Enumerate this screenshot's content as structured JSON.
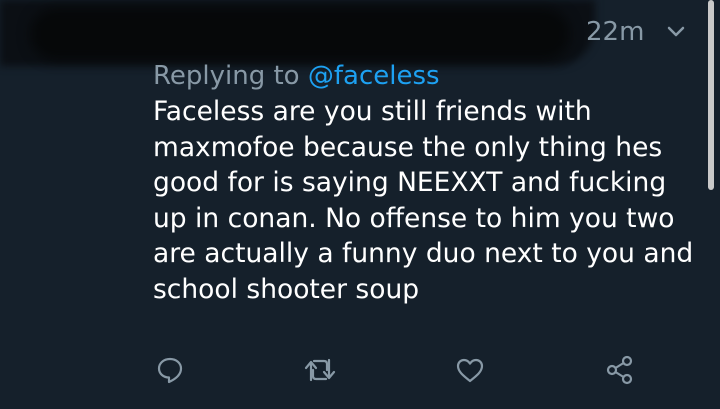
{
  "tweet": {
    "timestamp": "22m",
    "reply_prefix": "Replying to ",
    "reply_handle": "@faceless",
    "text": "Faceless are you still friends with\nmaxmofoe because the only thing hes\ngood for is saying NEEXXT and fucking\nup in conan. No offense to him you two\nare actually a funny duo next to you and\nschool shooter soup"
  },
  "icons": {
    "menu": "chevron-down-icon",
    "reply": "reply-icon",
    "retweet": "retweet-icon",
    "like": "heart-icon",
    "share": "share-icon"
  },
  "colors": {
    "background": "#15202b",
    "text": "#ffffff",
    "muted": "#8899a6",
    "link": "#1da1f2"
  }
}
